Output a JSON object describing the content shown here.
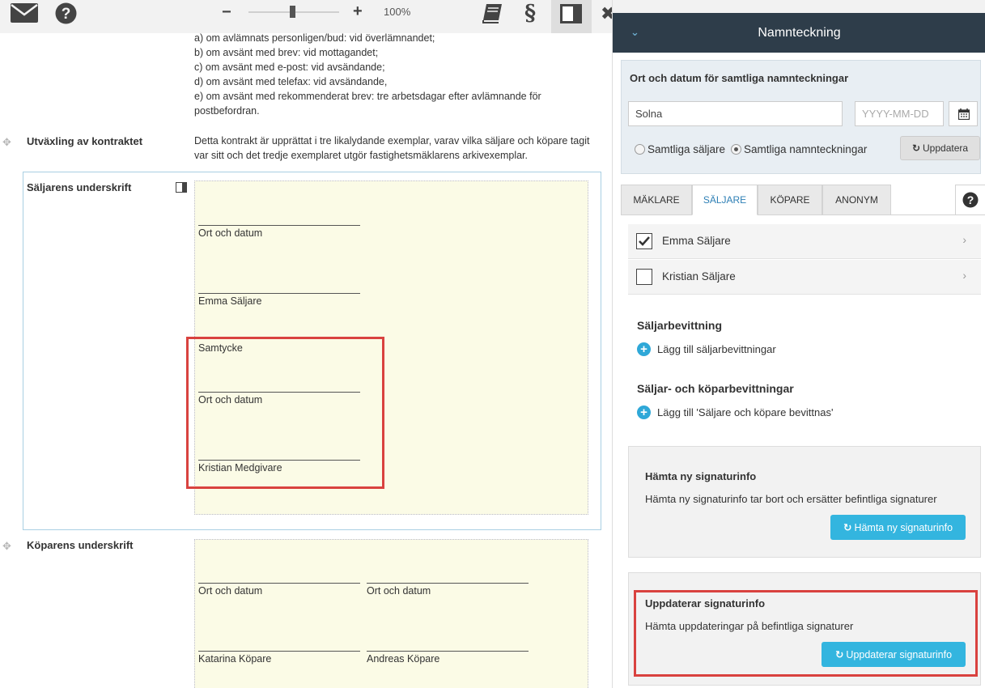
{
  "toolbar": {
    "zoom_minus": "−",
    "zoom_plus": "+",
    "zoom_value": "100%",
    "zoom_level_percent": 100,
    "icons": [
      "mail-icon",
      "help-icon",
      "book-icon",
      "section-icon",
      "panel-toggle-icon",
      "close-icon"
    ]
  },
  "document": {
    "delivery_lines": [
      "a) om avlämnats personligen/bud: vid överlämnandet;",
      "b) om avsänt med brev: vid mottagandet;",
      "c) om avsänt med e-post: vid avsändande;",
      "d) om avsänt med telefax: vid avsändande,",
      "e) om avsänt med rekommenderat brev: tre arbetsdagar efter avlämnande för",
      "postbefordran."
    ],
    "exchange_label": "Utväxling av kontraktet",
    "exchange_text_1": "Detta kontrakt är upprättat i tre likalydande exemplar, varav vilka säljare och köpare tagit",
    "exchange_text_2": "var sitt och det tredje exemplaret utgör fastighetsmäklarens arkivexemplar.",
    "seller_section_label": "Säljarens underskrift",
    "seller_sig": {
      "place_date_1": "Ort och datum",
      "seller_name": "Emma Säljare",
      "consent_label": "Samtycke",
      "place_date_2": "Ort och datum",
      "consenter_name": "Kristian Medgivare"
    },
    "buyer_section_label": "Köparens underskrift",
    "buyer_sig": {
      "place_date_1": "Ort och datum",
      "place_date_2": "Ort och datum",
      "buyer_1": "Katarina Köpare",
      "buyer_2": "Andreas Köpare"
    }
  },
  "panel": {
    "title": "Namnteckning",
    "place_date": {
      "title": "Ort och datum för samtliga namnteckningar",
      "place_value": "Solna",
      "date_placeholder": "YYYY-MM-DD",
      "radio_all_sellers": "Samtliga säljare",
      "radio_all_signatures": "Samtliga namnteckningar",
      "selected_radio": "Samtliga namnteckningar",
      "update_label": "Uppdatera"
    },
    "tabs": [
      {
        "label": "MÄKLARE"
      },
      {
        "label": "SÄLJARE"
      },
      {
        "label": "KÖPARE"
      },
      {
        "label": "ANONYM"
      }
    ],
    "active_tab": "SÄLJARE",
    "parties": [
      {
        "name": "Emma Säljare",
        "checked": true
      },
      {
        "name": "Kristian Säljare",
        "checked": false
      }
    ],
    "seller_witness_heading": "Säljarbevittning",
    "seller_witness_add": "Lägg till säljarbevittningar",
    "both_witness_heading": "Säljar- och köparbevittningar",
    "both_witness_add": "Lägg till 'Säljare och köpare bevittnas'",
    "fetch_card": {
      "title": "Hämta ny signaturinfo",
      "description": "Hämta ny signaturinfo tar bort och ersätter befintliga signaturer",
      "button": "Hämta ny signaturinfo"
    },
    "update_card": {
      "title": "Uppdaterar signaturinfo",
      "description": "Hämta uppdateringar på befintliga signaturer",
      "button": "Uppdaterar signaturinfo"
    }
  },
  "colors": {
    "header_bg": "#2e3d4a",
    "accent_blue": "#33b5df",
    "highlight_red": "#d9423f",
    "signature_bg": "#fbfbe6"
  }
}
